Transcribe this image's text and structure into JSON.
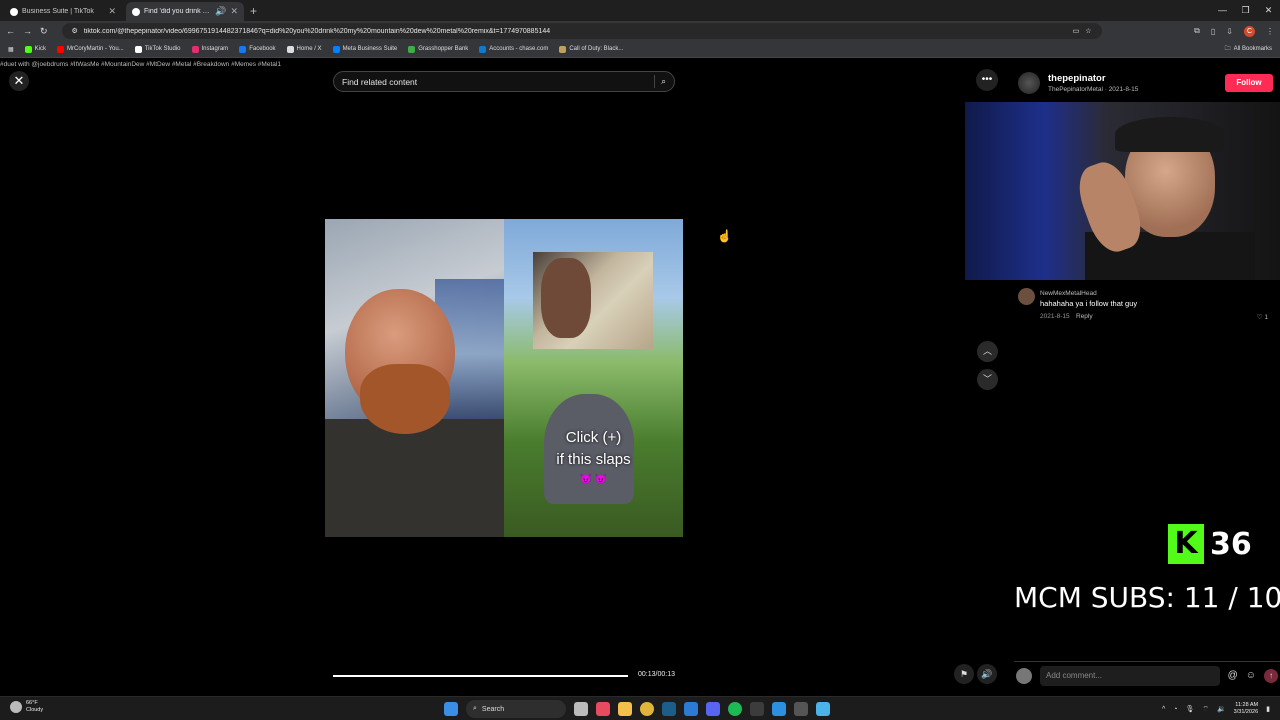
{
  "browser": {
    "tabs": [
      {
        "title": "Business Suite | TikTok",
        "active": false
      },
      {
        "title": "Find 'did you drink my mo",
        "active": true
      }
    ],
    "url": "tiktok.com/@thepepinator/video/6996751914482371846?q=did%20you%20drink%20my%20mountain%20dew%20metal%20remix&t=1774970885144",
    "bookmarks": [
      {
        "label": "Kick",
        "color": "#53fc18"
      },
      {
        "label": "MrCoryMartin - You...",
        "color": "#ff0000"
      },
      {
        "label": "TikTok Studio",
        "color": "#ffffff"
      },
      {
        "label": "Instagram",
        "color": "#e1306c"
      },
      {
        "label": "Facebook",
        "color": "#1877f2"
      },
      {
        "label": "Home / X",
        "color": "#dddddd"
      },
      {
        "label": "Meta Business Suite",
        "color": "#0081fb"
      },
      {
        "label": "Grasshopper Bank",
        "color": "#3cb043"
      },
      {
        "label": "Accounts - chase.com",
        "color": "#117aca"
      },
      {
        "label": "Call of Duty: Black...",
        "color": "#c0a060"
      }
    ],
    "all_bookmarks": "All Bookmarks"
  },
  "page": {
    "caption": "#duet with @joebdrums #ItWasMe #MountainDew #MtDew #Metal #Breakdown #Memes #Metal1",
    "search_placeholder": "Find related content",
    "overlay_text_line1": "Click (+)",
    "overlay_text_line2": "if this slaps",
    "overlay_emoji": "😈 😈",
    "time": "00:13/00:13",
    "progress": 1.0
  },
  "creator": {
    "username": "thepepinator",
    "display": "ThePepinatorMetal · 2021-8-15",
    "follow_label": "Follow"
  },
  "comment": {
    "user": "NewMexMetalHead",
    "text": "hahahaha ya i follow that guy",
    "date": "2021-8-15",
    "reply": "Reply",
    "likes": "1"
  },
  "overlay": {
    "kick_count": "36",
    "subs": "MCM SUBS:  11 / 10"
  },
  "comment_bar": {
    "placeholder": "Add comment..."
  },
  "taskbar": {
    "weather_temp": "66°F",
    "weather_desc": "Cloudy",
    "search_label": "Search",
    "time": "11:28 AM",
    "date": "3/31/2026"
  }
}
